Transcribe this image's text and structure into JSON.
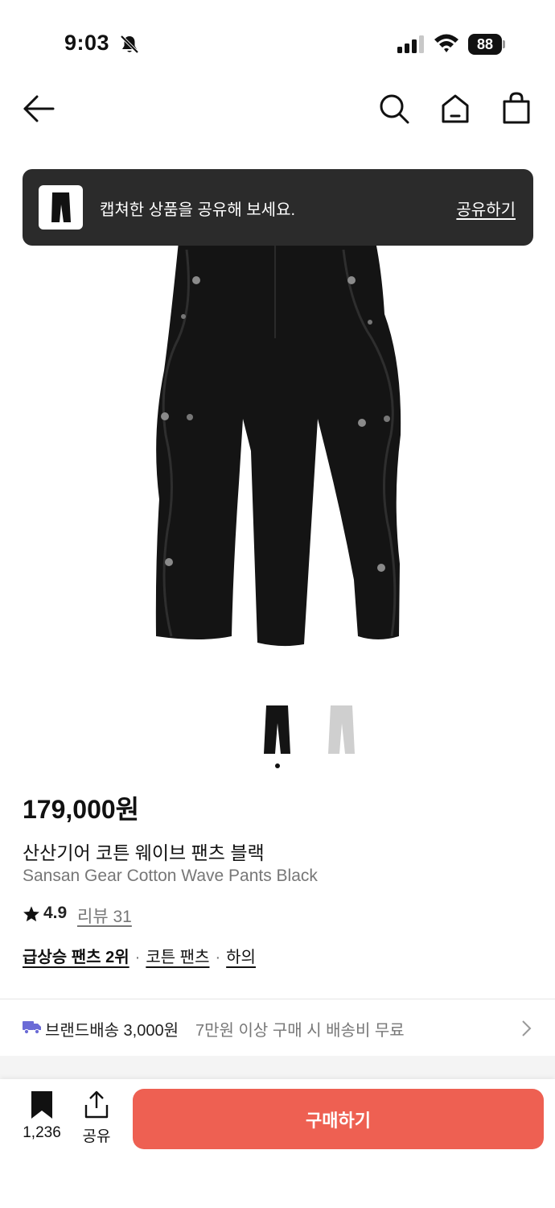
{
  "status_bar": {
    "time": "9:03",
    "battery": "88",
    "icons": [
      "bell-off-icon",
      "signal-icon",
      "wifi-icon",
      "battery-icon"
    ]
  },
  "nav": {
    "icons": [
      "back-arrow-icon",
      "search-icon",
      "home-icon",
      "shopping-bag-icon"
    ]
  },
  "toast": {
    "message": "캡쳐한 상품을 공유해 보세요.",
    "action": "공유하기"
  },
  "gallery": {
    "thumbnails": [
      "black",
      "gray"
    ],
    "selected_index": 0
  },
  "product": {
    "price": "179,000원",
    "name_ko": "산산기어 코튼 웨이브 팬츠 블랙",
    "name_en": "Sansan Gear Cotton Wave Pants Black",
    "rating": "4.9",
    "review_label": "리뷰 31",
    "categories": [
      {
        "label": "급상승 팬츠 2위",
        "bold": true
      },
      {
        "label": "코튼 팬츠",
        "bold": false
      },
      {
        "label": "하의",
        "bold": false
      }
    ],
    "category_separator": "·"
  },
  "shipping": {
    "label": "브랜드배송 3,000원",
    "note": "7만원 이상 구매 시 배송비 무료"
  },
  "bottom_bar": {
    "likes_count": "1,236",
    "share_label": "공유",
    "buy_label": "구매하기"
  },
  "colors": {
    "accent": "#ee6052",
    "toast_bg": "#2b2b2b",
    "muted_text": "#777777"
  }
}
